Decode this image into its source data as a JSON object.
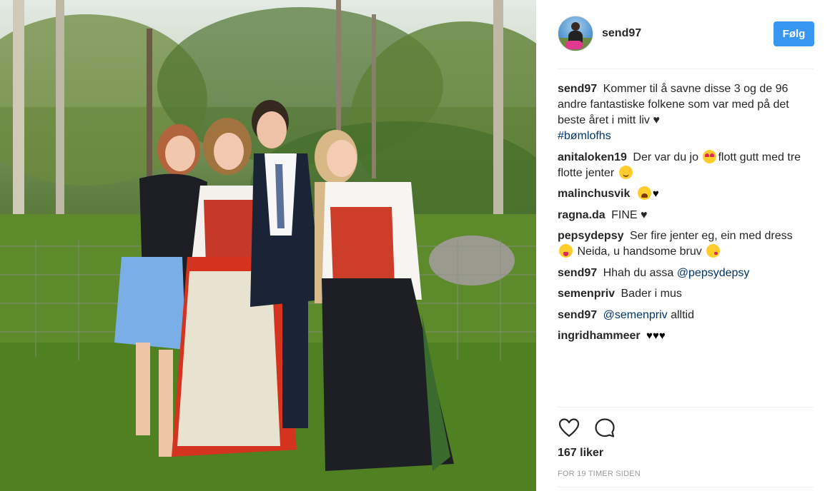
{
  "post": {
    "username": "send97",
    "follow_label": "Følg",
    "photo_alt": "",
    "likes_text": "167 liker",
    "time_text": "FOR 19 TIMER SIDEN"
  },
  "comments": [
    {
      "user": "send97",
      "text": "Kommer til å savne disse 3 og de 96 andre fantastiske folkene som var med på det beste året i mitt liv ♥",
      "hashtag": "#bømlofhs"
    },
    {
      "user": "anitaloken19",
      "text_before": "Der var du jo",
      "text_middle": "flott gutt med tre flotte jenter",
      "emoji_1": "heart-eyes-emoji",
      "emoji_2": "smile-emoji"
    },
    {
      "user": "malinchusvik",
      "text_after": "♥",
      "emoji": "weary-emoji"
    },
    {
      "user": "ragna.da",
      "text": "FINE ♥"
    },
    {
      "user": "pepsydepsy",
      "text_before": "Ser fire jenter eg, ein med dress",
      "text_middle": "Neida, u handsome bruv",
      "emoji_1": "tongue-emoji",
      "emoji_2": "wink-emoji"
    },
    {
      "user": "send97",
      "text": "Hhah du assa",
      "mention": "@pepsydepsy"
    },
    {
      "user": "semenpriv",
      "text": "Bader i mus"
    },
    {
      "user": "send97",
      "mention": "@semenpriv",
      "text": "alltid"
    },
    {
      "user": "ingridhammeer",
      "text": "♥♥♥"
    }
  ],
  "icons": {
    "like": "heart-outline-icon",
    "comment": "speech-bubble-icon",
    "follow_color": "#3897f0",
    "link_color": "#003569"
  }
}
